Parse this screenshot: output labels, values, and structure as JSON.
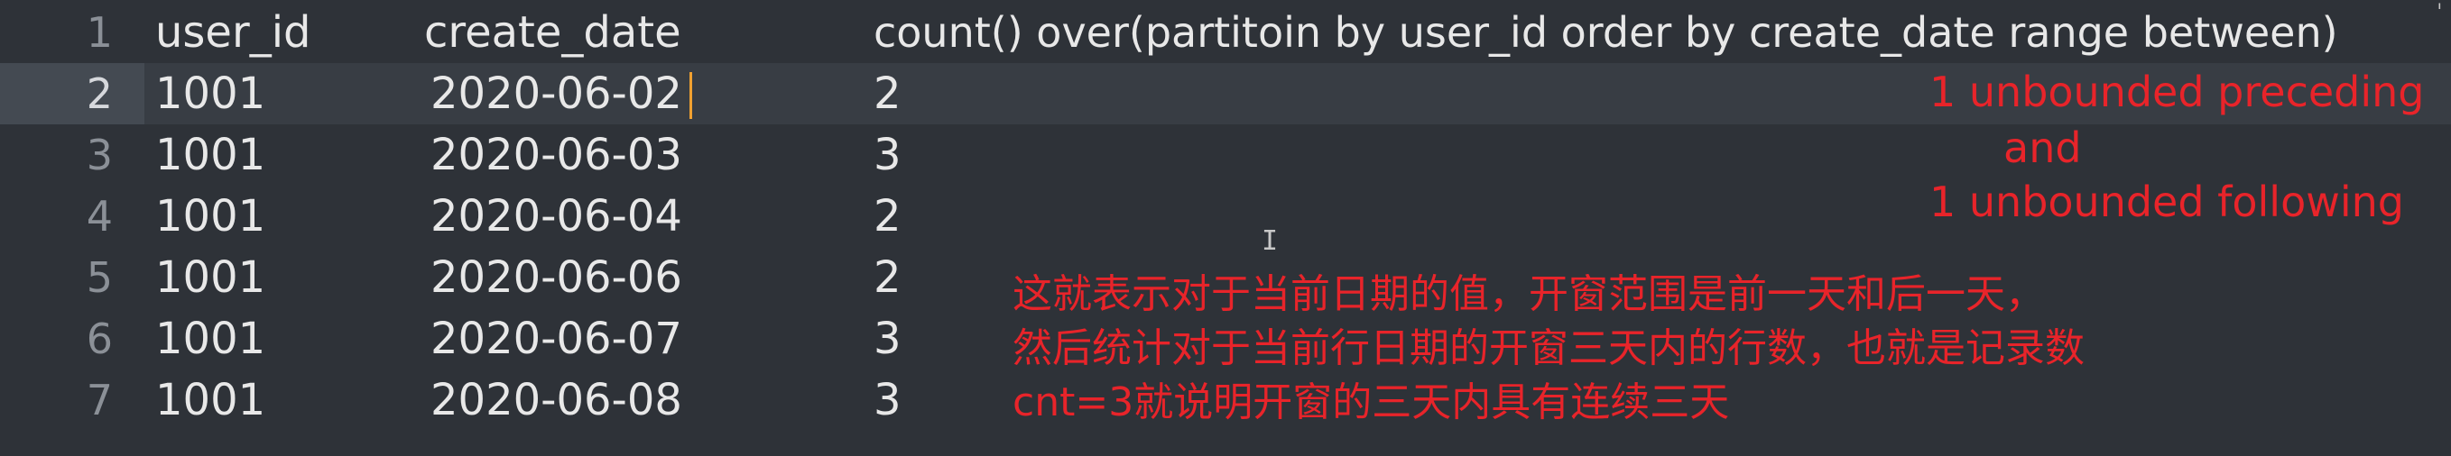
{
  "editor": {
    "line_numbers": [
      "1",
      "2",
      "3",
      "4",
      "5",
      "6",
      "7"
    ],
    "header": {
      "col1": "user_id",
      "col2": "create_date",
      "col3": "count() over(partitoin by user_id order by create_date range between)"
    },
    "rows": [
      {
        "user_id": "1001",
        "create_date": "2020-06-02",
        "count": "2"
      },
      {
        "user_id": "1001",
        "create_date": "2020-06-03",
        "count": "3"
      },
      {
        "user_id": "1001",
        "create_date": "2020-06-04",
        "count": "2"
      },
      {
        "user_id": "1001",
        "create_date": "2020-06-06",
        "count": "2"
      },
      {
        "user_id": "1001",
        "create_date": "2020-06-07",
        "count": "3"
      },
      {
        "user_id": "1001",
        "create_date": "2020-06-08",
        "count": "3"
      }
    ]
  },
  "annotations": {
    "range_line1": "1 unbounded preceding",
    "range_line2": "and",
    "range_line3": "1 unbounded following",
    "note_line1": "这就表示对于当前日期的值，开窗范围是前一天和后一天，",
    "note_line2": "然后统计对于当前行日期的开窗三天内的行数，也就是记录数",
    "note_line3": "cnt=3就说明开窗的三天内具有连续三天"
  },
  "colors": {
    "background": "#2e3238",
    "current_line": "#383d44",
    "text": "#e8e8e8",
    "annotation": "#e8242a",
    "caret": "#f0a030"
  }
}
